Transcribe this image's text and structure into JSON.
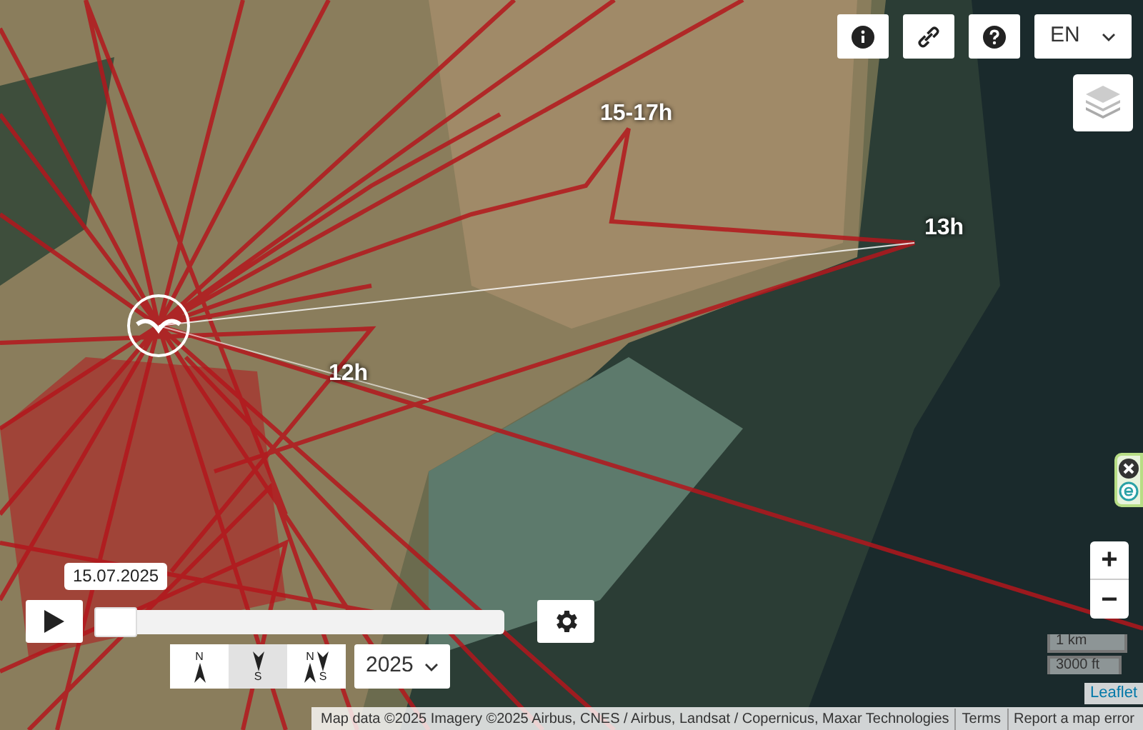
{
  "toolbar": {
    "buttons": [
      {
        "kind": "info"
      },
      {
        "kind": "link"
      },
      {
        "kind": "help"
      }
    ],
    "language": {
      "value": "EN"
    }
  },
  "layers_button": {
    "kind": "layers"
  },
  "side_widget": {
    "buttons": [
      {
        "kind": "close"
      },
      {
        "kind": "extension"
      }
    ]
  },
  "track_labels": [
    {
      "text": "15-17h"
    },
    {
      "text": "13h"
    },
    {
      "text": "12h"
    }
  ],
  "timeline": {
    "date": "15.07.2025",
    "level": 0.0
  },
  "direction_modes": [
    {
      "kind": "north",
      "labels": [
        "N"
      ],
      "selected": false
    },
    {
      "kind": "south",
      "labels": [
        "S"
      ],
      "selected": true
    },
    {
      "kind": "both",
      "labels": [
        "N",
        "S"
      ],
      "selected": false
    }
  ],
  "year_select": {
    "value": "2025"
  },
  "zoom": {
    "in": "+",
    "out": "−"
  },
  "scale": [
    "1 km",
    "3000 ft"
  ],
  "leaflet_link": "Leaflet",
  "attribution": [
    "Map data ©2025 Imagery ©2025 Airbus, CNES / Airbus, Landsat / Copernicus, Maxar Technologies",
    "Terms",
    "Report a map error"
  ]
}
